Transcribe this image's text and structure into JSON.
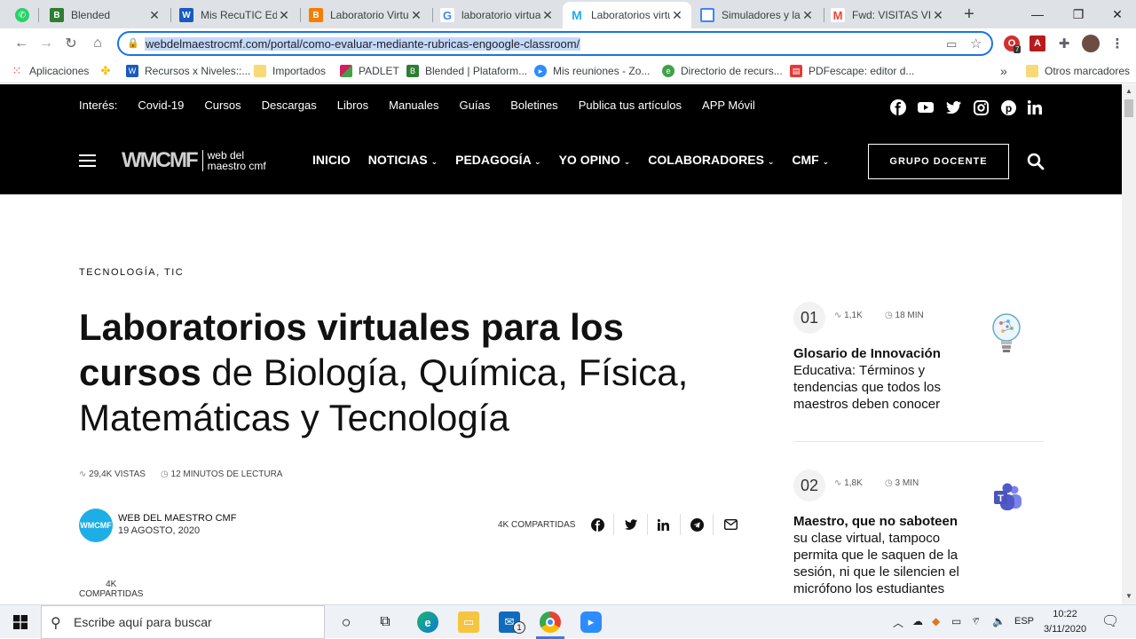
{
  "browser": {
    "tabs": [
      {
        "title": "",
        "icon": "whatsapp-icon",
        "color": "#25d366"
      },
      {
        "title": "Blended",
        "icon": "blended-icon",
        "color": "#2e7d32"
      },
      {
        "title": "Mis RecuTIC Ed S",
        "icon": "word-icon",
        "color": "#185abd"
      },
      {
        "title": "Laboratorio Virtu",
        "icon": "blogger-icon",
        "color": "#f57d00"
      },
      {
        "title": "laboratorio virtua",
        "icon": "google-icon",
        "color": "#4285f4"
      },
      {
        "title": "Laboratorios virtu",
        "icon": "webdelmaestro-icon",
        "color": "#1eaee6",
        "active": true
      },
      {
        "title": "Simuladores y lab",
        "icon": "docs-icon",
        "color": "#4285f4"
      },
      {
        "title": "Fwd: VISITAS VIR",
        "icon": "gmail-icon",
        "color": "#ea4335"
      }
    ],
    "url": "webdelmaestrocmf.com/portal/como-evaluar-mediante-rubricas-engoogle-classroom/",
    "extension_badge": "7",
    "bookmarks": [
      {
        "label": "Aplicaciones",
        "icon": "apps-grid-icon",
        "color": "#e94235"
      },
      {
        "label": "",
        "icon": "pinwheel-icon",
        "color": "#fbbc04"
      },
      {
        "label": "Recursos x Niveles::...",
        "icon": "word-icon",
        "color": "#185abd"
      },
      {
        "label": "Importados",
        "icon": "folder-icon",
        "color": "#f9d977"
      },
      {
        "label": "PADLET",
        "icon": "padlet-icon",
        "color": "#d81b60"
      },
      {
        "label": "Blended | Plataform...",
        "icon": "blended-icon",
        "color": "#2e7d32"
      },
      {
        "label": "Mis reuniones - Zo...",
        "icon": "zoom-icon",
        "color": "#2d8cff"
      },
      {
        "label": "Directorio de recurs...",
        "icon": "directory-icon",
        "color": "#43a047"
      },
      {
        "label": "PDFescape: editor d...",
        "icon": "pdf-icon",
        "color": "#e53935"
      }
    ],
    "more_bookmarks": "»",
    "other_bookmarks": "Otros marcadores"
  },
  "site": {
    "interest_label": "Interés:",
    "top_links": [
      "Covid-19",
      "Cursos",
      "Descargas",
      "Libros",
      "Manuales",
      "Guías",
      "Boletines",
      "Publica tus artículos",
      "APP Móvil"
    ],
    "logo_mark": "WMCMF",
    "logo_text_1": "web del",
    "logo_text_2": "maestro cmf",
    "nav": [
      {
        "label": "INICIO",
        "dropdown": false
      },
      {
        "label": "NOTICIAS",
        "dropdown": true
      },
      {
        "label": "PEDAGOGÍA",
        "dropdown": true
      },
      {
        "label": "YO OPINO",
        "dropdown": true
      },
      {
        "label": "COLABORADORES",
        "dropdown": true
      },
      {
        "label": "CMF",
        "dropdown": true
      }
    ],
    "group_button": "GRUPO DOCENTE"
  },
  "article": {
    "categories": "TECNOLOGÍA, TIC",
    "title_bold": "Laboratorios virtuales para los cursos",
    "title_rest": "de Biología, Química, Física, Matemáticas y Tecnología",
    "views": "29,4K VISTAS",
    "read_time": "12 MINUTOS DE LECTURA",
    "avatar_text": "WMCMF",
    "author": "WEB DEL MAESTRO CMF",
    "date": "19 AGOSTO, 2020",
    "shares": "4K COMPARTIDAS",
    "left_count": "4K",
    "left_count_label": "COMPARTIDAS"
  },
  "sidebar": [
    {
      "num": "01",
      "views": "1,1K",
      "time": "18 MIN",
      "title_bold": "Glosario de Innovación",
      "title_rest": "Educativa: Términos y tendencias que todos los maestros deben conocer",
      "thumb": "lightbulb-icon"
    },
    {
      "num": "02",
      "views": "1,8K",
      "time": "3 MIN",
      "title_bold": "Maestro, que no saboteen",
      "title_rest": "su clase virtual, tampoco permita que le saquen de la sesión, ni que le silencien el micrófono los estudiantes",
      "thumb": "teams-icon"
    }
  ],
  "taskbar": {
    "search_placeholder": "Escribe aquí para buscar",
    "mail_badge": "1",
    "language": "ESP",
    "time": "10:22",
    "date": "3/11/2020"
  }
}
